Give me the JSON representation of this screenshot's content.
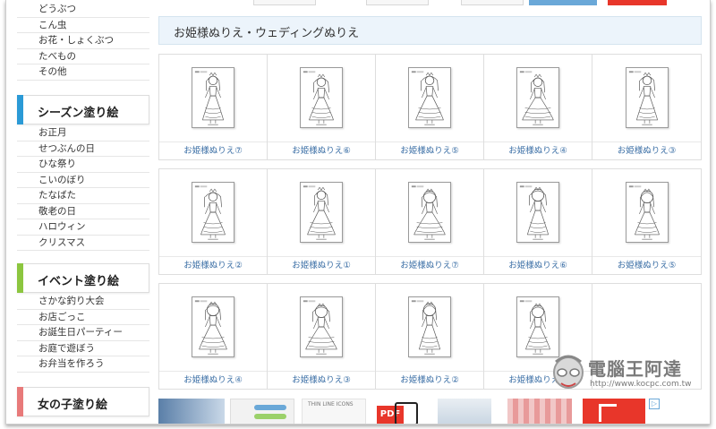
{
  "sidebar": {
    "top_items": [
      "どうぶつ",
      "こん虫",
      "お花・しょくぶつ",
      "たべもの",
      "その他"
    ],
    "sections": [
      {
        "title": "シーズン塗り絵",
        "color": "#2b9ad6",
        "items": [
          "お正月",
          "せつぶんの日",
          "ひな祭り",
          "こいのぼり",
          "たなばた",
          "敬老の日",
          "ハロウィン",
          "クリスマス"
        ]
      },
      {
        "title": "イベント塗り絵",
        "color": "#8cc63f",
        "items": [
          "さかな釣り大会",
          "お店ごっこ",
          "お誕生日パーティー",
          "お庭で遊ぼう",
          "お弁当を作ろう"
        ]
      },
      {
        "title": "女の子塗り絵",
        "color": "#e87a7a",
        "items": []
      }
    ]
  },
  "page": {
    "title": "お姫様ぬりえ・ウェディングぬりえ"
  },
  "gallery": {
    "rows": [
      [
        "お姫様ぬりえ⑦",
        "お姫様ぬりえ⑥",
        "お姫様ぬりえ⑤",
        "お姫様ぬりえ④",
        "お姫様ぬりえ③"
      ],
      [
        "お姫様ぬりえ②",
        "お姫様ぬりえ①",
        "お姫様ぬりえ⑦",
        "お姫様ぬりえ⑥",
        "お姫様ぬりえ⑤"
      ],
      [
        "お姫様ぬりえ④",
        "お姫様ぬりえ③",
        "お姫様ぬりえ②",
        "お姫様ぬりえ①"
      ]
    ]
  },
  "ads": {
    "thin_line_icons": "THIN LINE ICONS",
    "pdf": "PDF"
  },
  "watermark": {
    "name": "電腦王阿達",
    "url": "http://www.kocpc.com.tw"
  },
  "colors": {
    "link": "#3a6ea5",
    "title_bg": "#ecf4fb",
    "adobe_red": "#e8362a"
  }
}
